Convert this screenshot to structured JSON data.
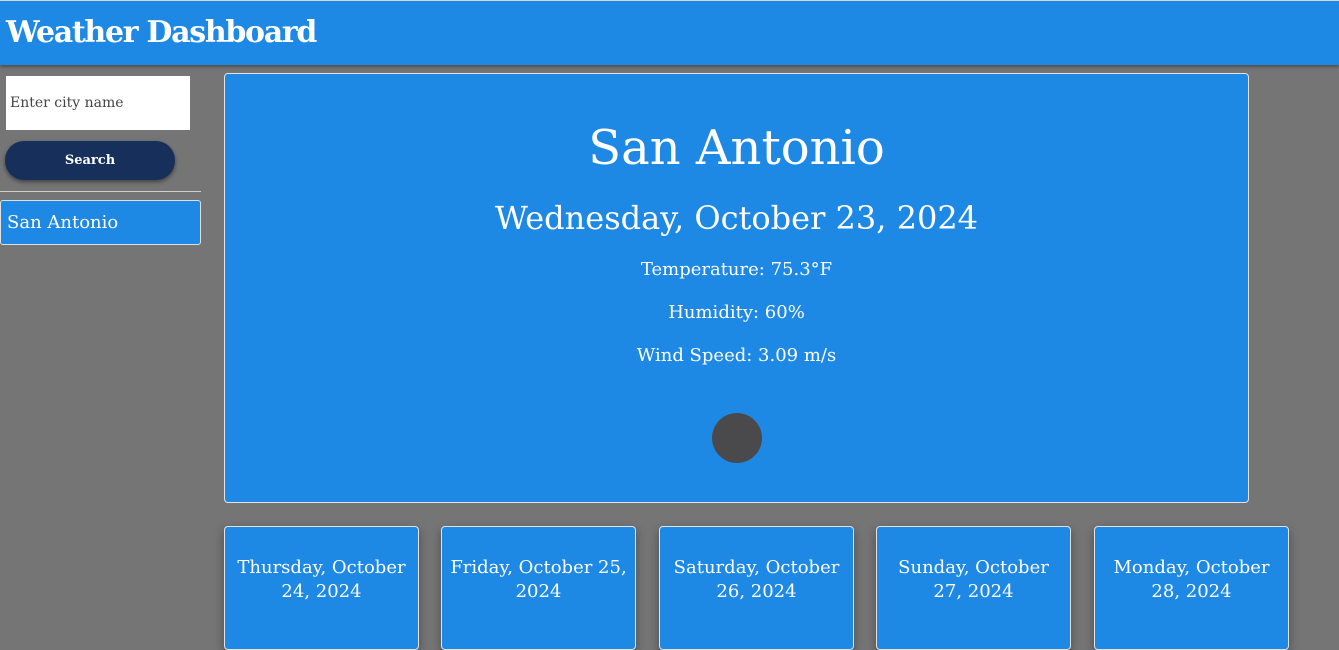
{
  "header": {
    "title": "Weather Dashboard"
  },
  "sidebar": {
    "search": {
      "placeholder": "Enter city name",
      "value": ""
    },
    "search_button_label": "Search",
    "history": [
      {
        "label": "San Antonio"
      }
    ]
  },
  "current": {
    "city": "San Antonio",
    "date": "Wednesday, October 23, 2024",
    "temperature": "Temperature: 75.3°F",
    "humidity": "Humidity: 60%",
    "wind": "Wind Speed: 3.09 m/s",
    "icon": "weather-icon"
  },
  "forecast": [
    {
      "date": "Thursday, October 24, 2024"
    },
    {
      "date": "Friday, October 25, 2024"
    },
    {
      "date": "Saturday, October 26, 2024"
    },
    {
      "date": "Sunday, October 27, 2024"
    },
    {
      "date": "Monday, October 28, 2024"
    }
  ],
  "colors": {
    "primary": "#1e88e5",
    "background": "#757575",
    "button": "#17305b",
    "icon": "#4a4a4c"
  }
}
